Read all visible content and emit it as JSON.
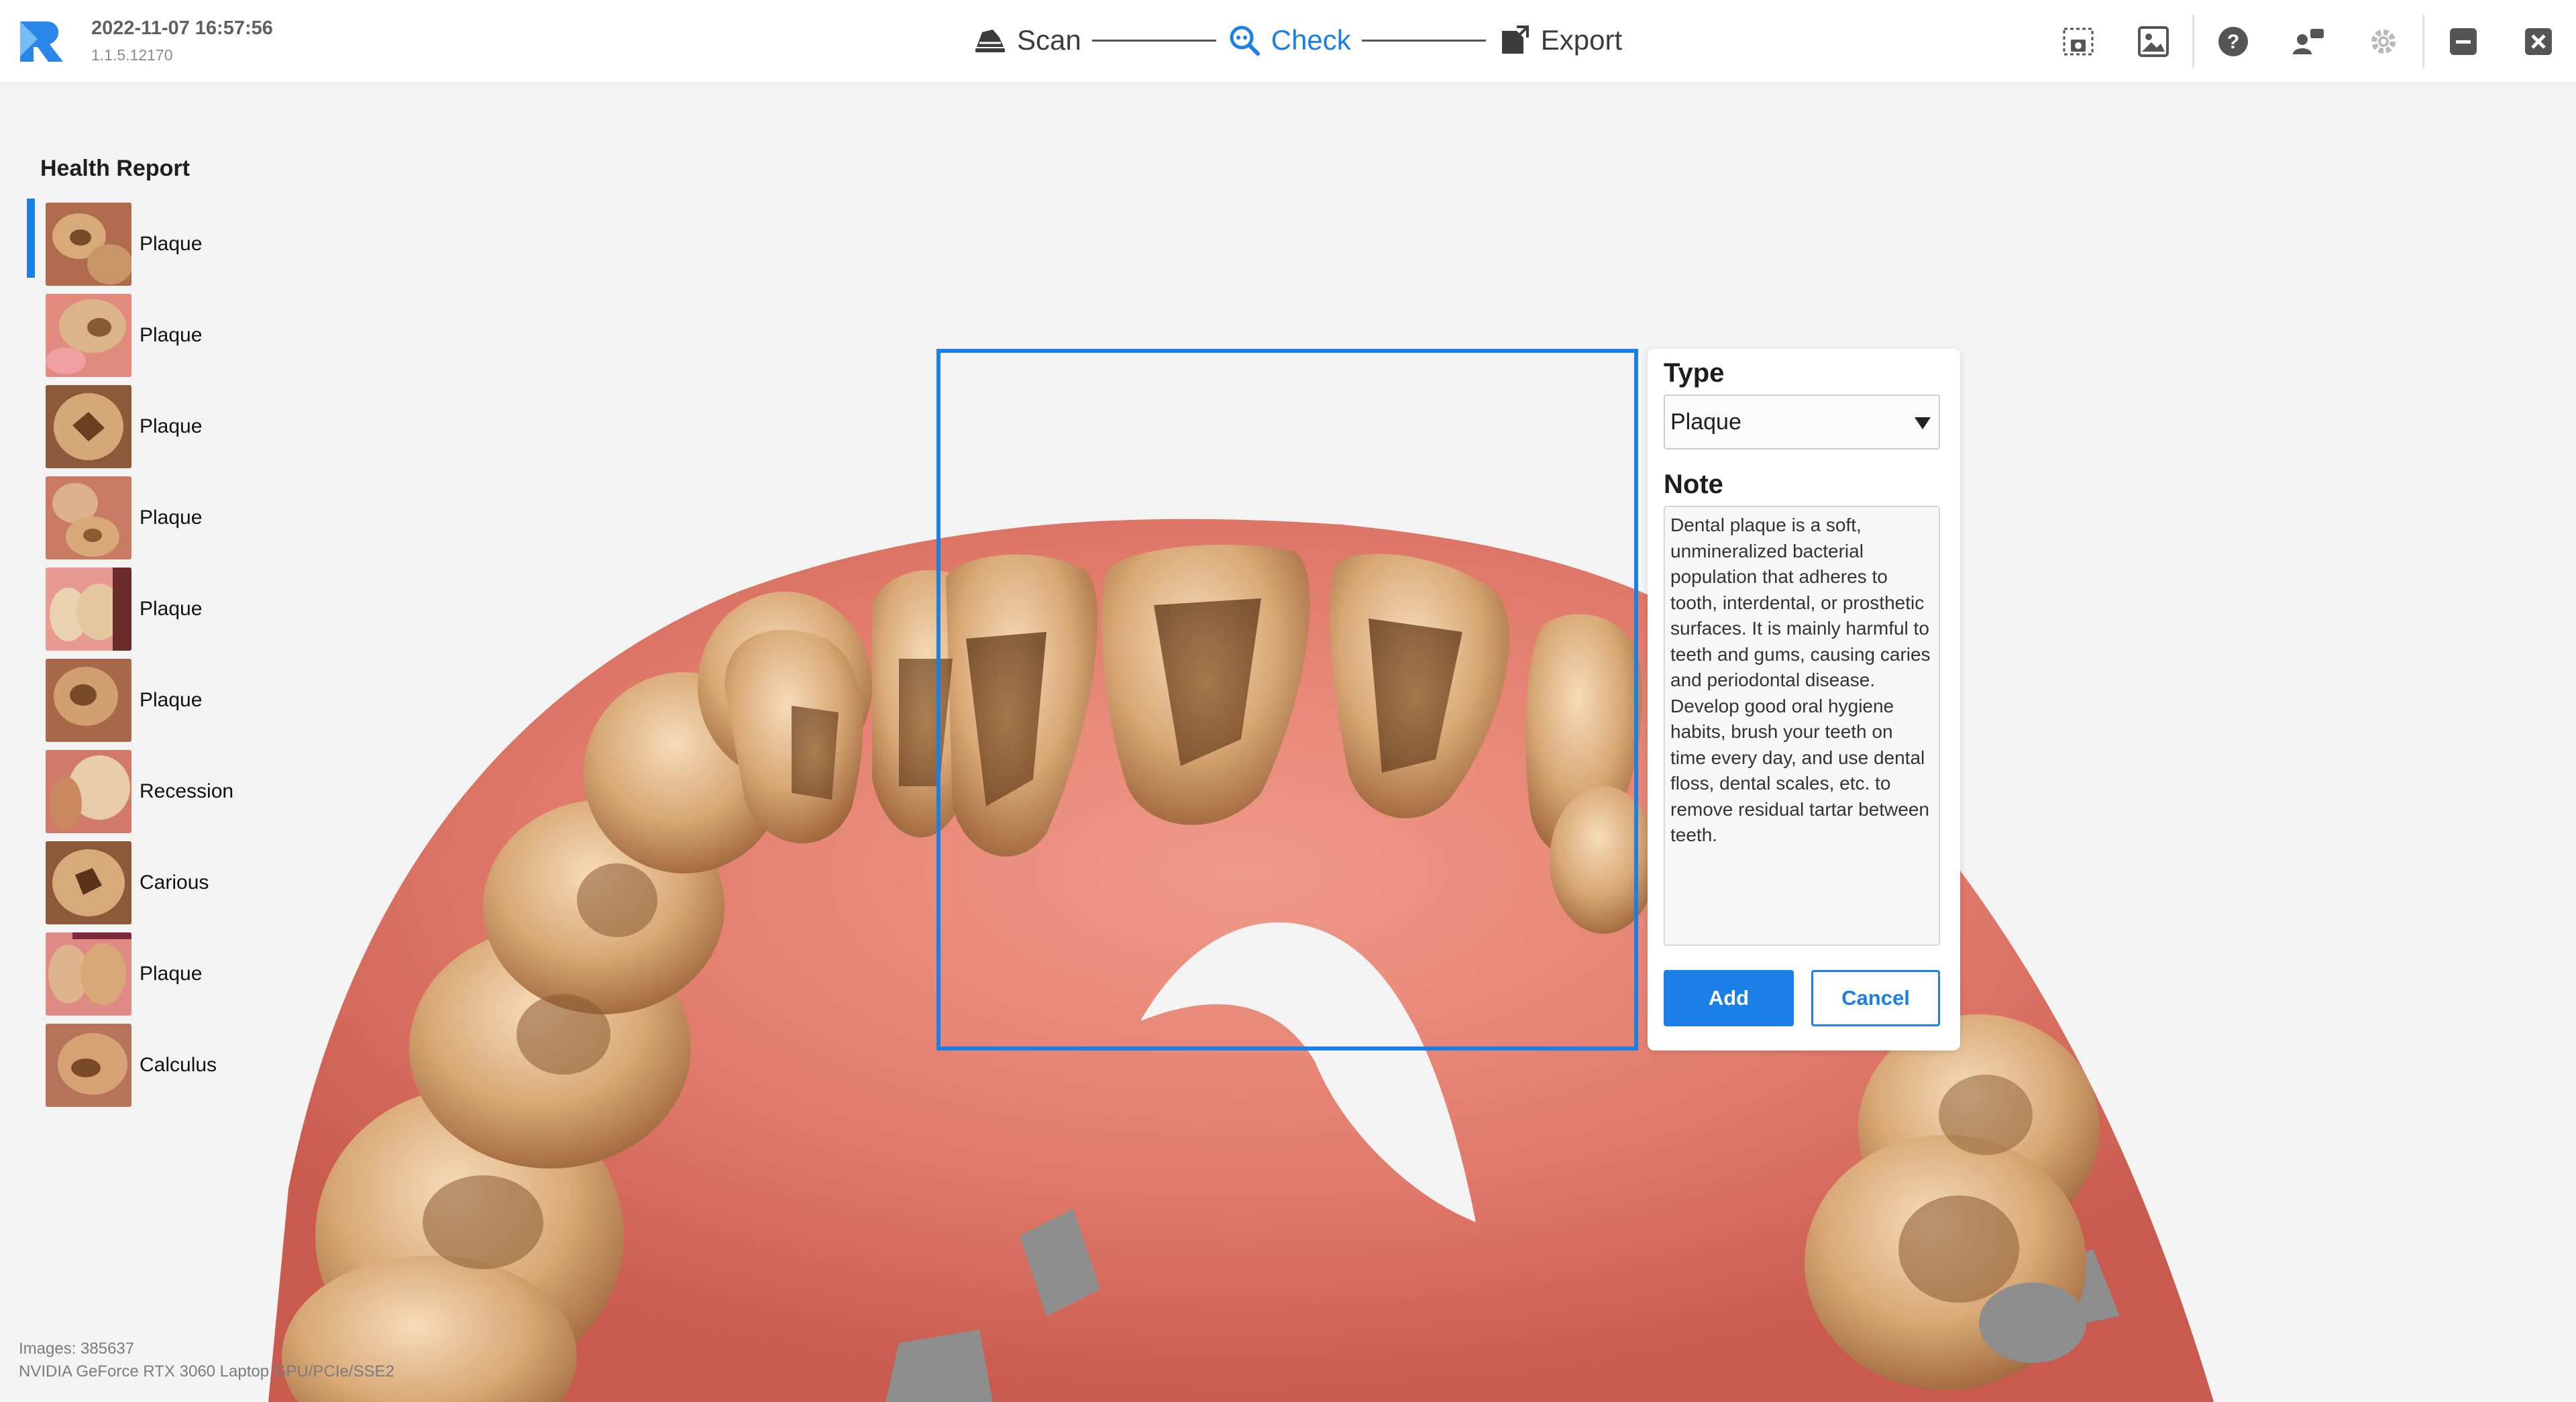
{
  "app": {
    "timestamp": "2022-11-07 16:57:56",
    "version": "1.1.5.12170",
    "accent_color": "#1a7fe6"
  },
  "steps": [
    {
      "label": "Scan",
      "icon": "scanner-icon",
      "active": false
    },
    {
      "label": "Check",
      "icon": "magnifier-icon",
      "active": true
    },
    {
      "label": "Export",
      "icon": "export-icon",
      "active": false
    }
  ],
  "toolbar": [
    {
      "icon": "snapshot-icon"
    },
    {
      "icon": "gallery-icon"
    },
    {
      "icon": "help-icon"
    },
    {
      "icon": "remote-support-icon"
    },
    {
      "icon": "settings-icon"
    },
    {
      "icon": "minimize-icon"
    },
    {
      "icon": "close-icon"
    }
  ],
  "report": {
    "title": "Health Report",
    "items": [
      {
        "label": "Plaque",
        "selected": true
      },
      {
        "label": "Plaque"
      },
      {
        "label": "Plaque"
      },
      {
        "label": "Plaque"
      },
      {
        "label": "Plaque"
      },
      {
        "label": "Plaque"
      },
      {
        "label": "Recession"
      },
      {
        "label": "Carious"
      },
      {
        "label": "Plaque"
      },
      {
        "label": "Calculus"
      }
    ]
  },
  "panel": {
    "type_label": "Type",
    "type_value": "Plaque",
    "note_label": "Note",
    "note_text": "Dental plaque is a soft, unmineralized bacterial population that adheres to tooth, interdental, or prosthetic surfaces. It is mainly harmful to teeth and gums, causing caries and periodontal disease. Develop good oral hygiene habits, brush your teeth on time every day, and use dental floss, dental scales, etc. to remove residual tartar between teeth.",
    "add_label": "Add",
    "cancel_label": "Cancel"
  },
  "footer": {
    "images": "Images: 385637",
    "gpu": "NVIDIA GeForce RTX 3060 Laptop GPU/PCIe/SSE2"
  }
}
